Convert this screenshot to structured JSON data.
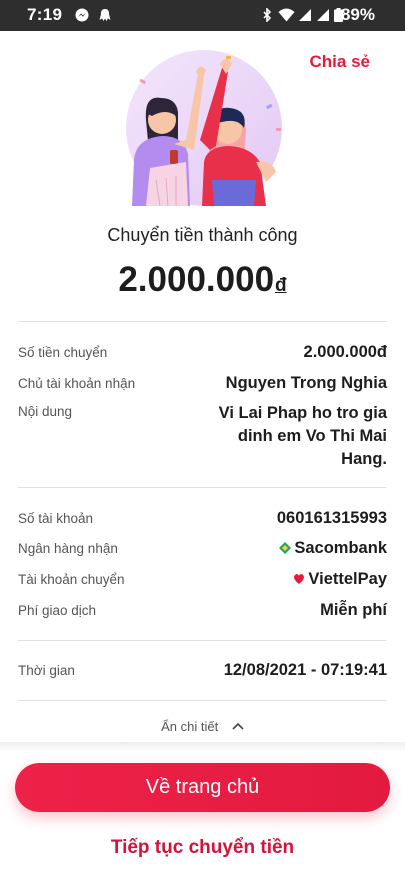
{
  "status_bar": {
    "time": "7:19",
    "battery": "89%"
  },
  "header": {
    "share_label": "Chia sẻ"
  },
  "result": {
    "title": "Chuyển tiền thành công",
    "amount": "2.000.000",
    "currency": "đ"
  },
  "details": {
    "amount_label": "Số tiền chuyển",
    "amount_value": "2.000.000đ",
    "receiver_label": "Chủ tài khoản nhận",
    "receiver_value": "Nguyen Trong Nghia",
    "content_label": "Nội dung",
    "content_value": "Vi Lai Phap ho tro gia dinh em Vo Thi Mai Hang.",
    "account_label": "Số tài khoản",
    "account_value": "060161315993",
    "bank_label": "Ngân hàng nhận",
    "bank_value": "Sacombank",
    "source_label": "Tài khoản chuyển",
    "source_value": "ViettelPay",
    "fee_label": "Phí giao dịch",
    "fee_value": "Miễn phí",
    "time_label": "Thời gian",
    "time_value": "12/08/2021 - 07:19:41"
  },
  "toggle_details_label": "Ẩn chi tiết",
  "actions": {
    "home_label": "Về trang chủ",
    "continue_label": "Tiếp tục chuyển tiền"
  },
  "colors": {
    "accent": "#e8193a",
    "statusbar": "#2e2e2e",
    "sacombank": "#27a35a",
    "viettelpay": "#e8193a"
  },
  "icons": [
    "messenger-icon",
    "ghost-icon",
    "bluetooth-icon",
    "wifi-icon",
    "signal-icon",
    "battery-icon",
    "sacombank-logo-icon",
    "viettelpay-logo-icon",
    "chevron-up-icon"
  ]
}
